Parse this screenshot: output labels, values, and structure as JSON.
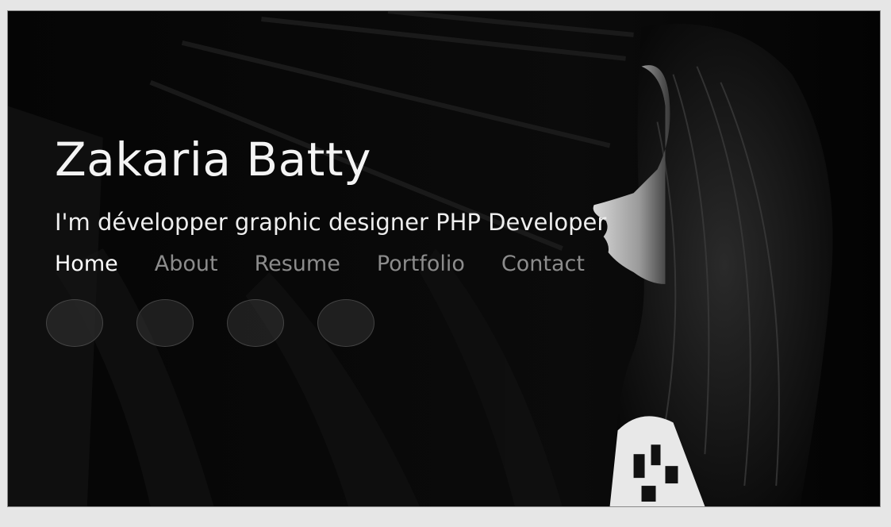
{
  "hero": {
    "name": "Zakaria Batty",
    "tagline": "I'm développer graphic designer PHP Developer"
  },
  "nav": {
    "items": [
      "Home",
      "About",
      "Resume",
      "Portfolio",
      "Contact"
    ],
    "active": "Home"
  },
  "social": {
    "count": 4
  },
  "colors": {
    "background": "#060606",
    "text_primary": "#f4f4f4",
    "nav_inactive": "#8c8c8c",
    "page_border": "#e6e6e6"
  }
}
